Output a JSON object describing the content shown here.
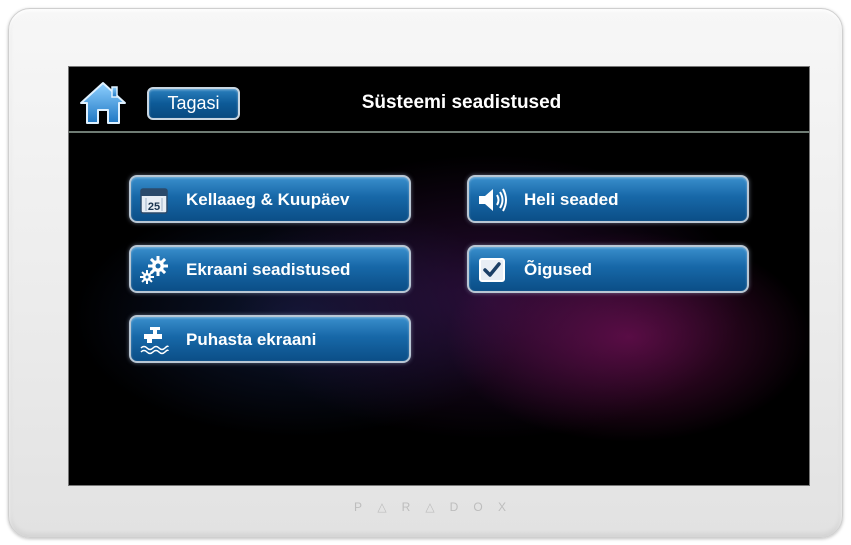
{
  "header": {
    "title": "Süsteemi seadistused",
    "back_label": "Tagasi"
  },
  "menu": {
    "datetime": {
      "label": "Kellaaeg & Kuupäev",
      "icon": "calendar-icon",
      "icon_text": "25"
    },
    "sound": {
      "label": "Heli seaded",
      "icon": "speaker-icon"
    },
    "display": {
      "label": "Ekraani seadistused",
      "icon": "gears-icon"
    },
    "rights": {
      "label": "Õigused",
      "icon": "checkbox-icon"
    },
    "clean": {
      "label": "Puhasta ekraani",
      "icon": "faucet-icon"
    }
  },
  "device": {
    "brand": "PARADOX"
  },
  "colors": {
    "button_top": "#3a8fcc",
    "button_bottom": "#0b4e87",
    "home_icon": "#4aa3e0"
  }
}
